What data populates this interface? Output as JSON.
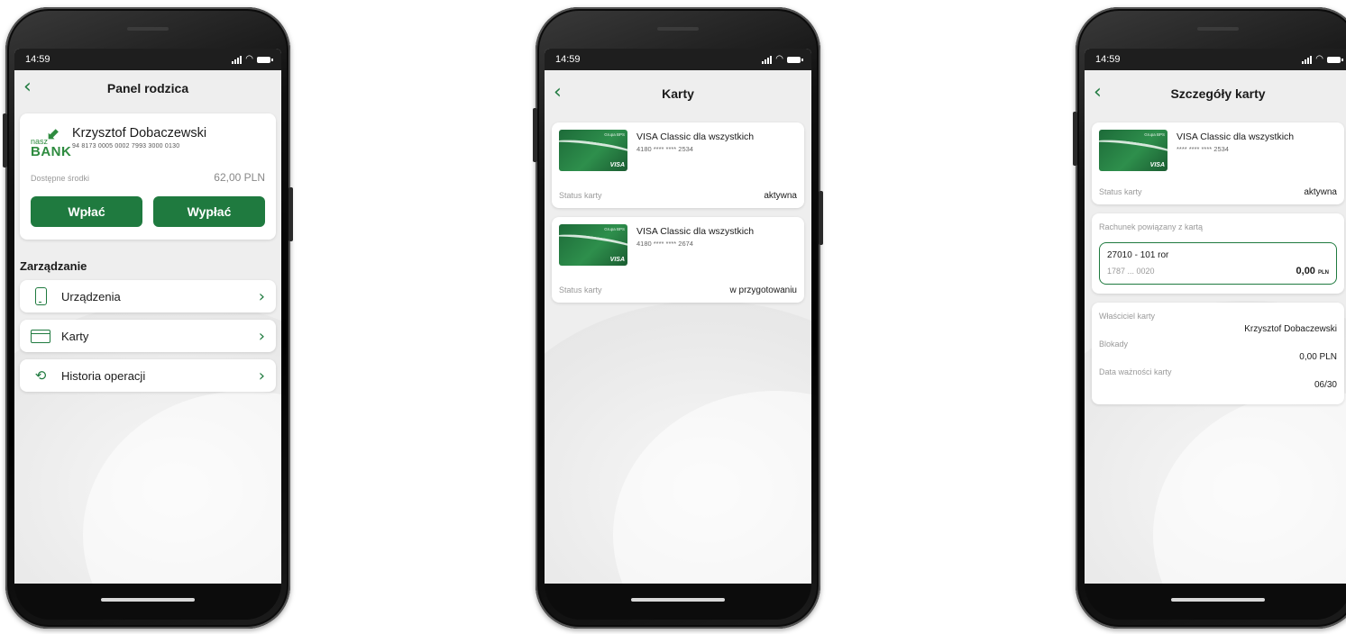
{
  "status_bar": {
    "time": "14:59"
  },
  "phone1": {
    "title": "Panel rodzica",
    "account": {
      "logo_top": "nasz",
      "logo_bottom": "BANK",
      "holder": "Krzysztof Dobaczewski",
      "number": "94 8173 0005 0002 7993 3000 0130",
      "available_label": "Dostępne środki",
      "available_amount": "62,00 PLN"
    },
    "buttons": {
      "deposit": "Wpłać",
      "withdraw": "Wypłać"
    },
    "section_title": "Zarządzanie",
    "nav": [
      {
        "label": "Urządzenia",
        "icon": "phone-icon"
      },
      {
        "label": "Karty",
        "icon": "credit-card-icon"
      },
      {
        "label": "Historia operacji",
        "icon": "history-icon"
      }
    ]
  },
  "phone2": {
    "title": "Karty",
    "cards": [
      {
        "name": "VISA Classic dla wszystkich",
        "number": "4180 **** **** 2534",
        "status_label": "Status karty",
        "status": "aktywna"
      },
      {
        "name": "VISA Classic dla wszystkich",
        "number": "4180 **** **** 2674",
        "status_label": "Status karty",
        "status": "w przygotowaniu"
      }
    ]
  },
  "phone3": {
    "title": "Szczegóły karty",
    "card": {
      "name": "VISA Classic dla wszystkich",
      "number": "**** **** **** 2534",
      "status_label": "Status karty",
      "status": "aktywna"
    },
    "linked": {
      "label": "Rachunek powiązany z kartą",
      "account_name": "27010 - 101 ror",
      "account_short": "1787 ... 0020",
      "amount": "0,00",
      "currency": "PLN"
    },
    "details": {
      "owner_label": "Właściciel karty",
      "owner": "Krzysztof Dobaczewski",
      "blocks_label": "Blokady",
      "blocks": "0,00 PLN",
      "expiry_label": "Data ważności karty",
      "expiry": "06/30"
    }
  },
  "card_art": {
    "brand_text": "Grupa BPS",
    "visa_text": "VISA"
  },
  "colors": {
    "accent": "#1f7a3f",
    "background": "#eeeeee",
    "card": "#ffffff"
  }
}
